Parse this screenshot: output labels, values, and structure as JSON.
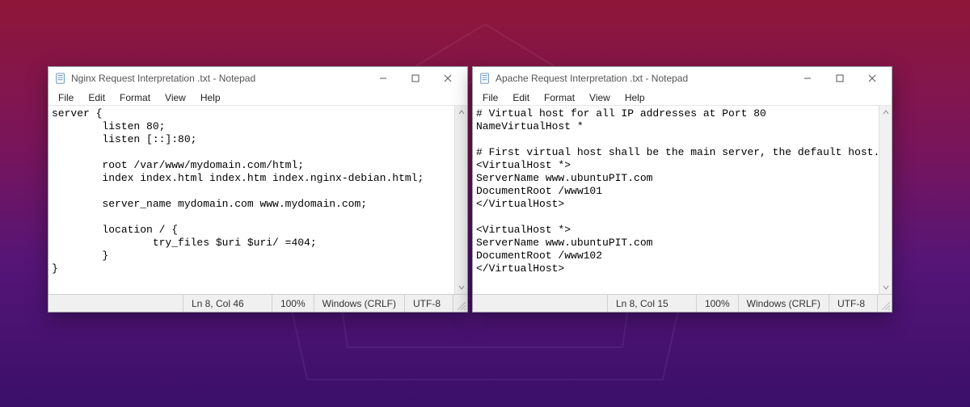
{
  "windows": [
    {
      "id": "nginx",
      "title": "Nginx Request Interpretation .txt - Notepad",
      "menu": [
        "File",
        "Edit",
        "Format",
        "View",
        "Help"
      ],
      "body": "server {\n        listen 80;\n        listen [::]:80;\n\n        root /var/www/mydomain.com/html;\n        index index.html index.htm index.nginx-debian.html;\n\n        server_name mydomain.com www.mydomain.com;\n\n        location / {\n                try_files $uri $uri/ =404;\n        }\n}",
      "status": {
        "pos": "Ln 8, Col 46",
        "zoom": "100%",
        "eol": "Windows (CRLF)",
        "enc": "UTF-8"
      }
    },
    {
      "id": "apache",
      "title": "Apache Request Interpretation .txt - Notepad",
      "menu": [
        "File",
        "Edit",
        "Format",
        "View",
        "Help"
      ],
      "body": "# Virtual host for all IP addresses at Port 80\nNameVirtualHost *\n\n# First virtual host shall be the main server, the default host.\n<VirtualHost *>\nServerName www.ubuntuPIT.com\nDocumentRoot /www101\n</VirtualHost>\n\n<VirtualHost *>\nServerName www.ubuntuPIT.com\nDocumentRoot /www102\n</VirtualHost>",
      "status": {
        "pos": "Ln 8, Col 15",
        "zoom": "100%",
        "eol": "Windows (CRLF)",
        "enc": "UTF-8"
      }
    }
  ]
}
